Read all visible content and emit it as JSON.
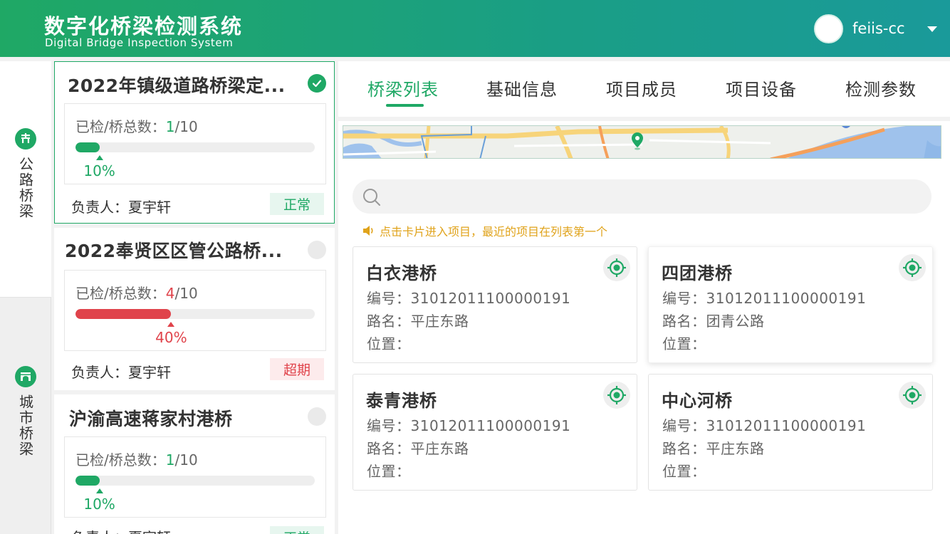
{
  "header": {
    "title": "数字化桥梁检测系统",
    "subtitle": "Digital Bridge Inspection System",
    "username": "feiis-cc"
  },
  "type_nav": {
    "items": [
      {
        "label": "公路桥梁",
        "icon": "highway-bridge-icon",
        "active": true
      },
      {
        "label": "城市桥梁",
        "icon": "city-bridge-icon",
        "active": false
      }
    ]
  },
  "projects": [
    {
      "name": "2022年镇级道路桥梁定...",
      "progress_label": "已检/桥总数：",
      "checked": "1",
      "total": "/10",
      "percent": 10,
      "percent_text": "10%",
      "owner": "负责人：夏宇轩",
      "status": "正常",
      "status_type": "ok",
      "selected": true
    },
    {
      "name": "2022奉贤区区管公路桥...",
      "progress_label": "已检/桥总数：",
      "checked": "4",
      "total": "/10",
      "percent": 40,
      "percent_text": "40%",
      "owner": "负责人：夏宇轩",
      "status": "超期",
      "status_type": "late",
      "selected": false
    },
    {
      "name": "沪渝高速蒋家村港桥",
      "progress_label": "已检/桥总数：",
      "checked": "1",
      "total": "/10",
      "percent": 10,
      "percent_text": "10%",
      "owner": "负责人：夏宇轩",
      "status": "正常",
      "status_type": "ok",
      "selected": false
    }
  ],
  "tabs": [
    {
      "label": "桥梁列表",
      "active": true
    },
    {
      "label": "基础信息",
      "active": false
    },
    {
      "label": "项目成员",
      "active": false
    },
    {
      "label": "项目设备",
      "active": false
    },
    {
      "label": "检测参数",
      "active": false
    }
  ],
  "search": {
    "placeholder": ""
  },
  "hint": "点击卡片进入项目，最近的项目在列表第一个",
  "bridges": [
    {
      "name": "白衣港桥",
      "code": "编号：31012011100000191",
      "road": "路名：平庄东路",
      "location": "位置："
    },
    {
      "name": "四团港桥",
      "code": "编号：31012011100000191",
      "road": "路名：团青公路",
      "location": "位置："
    },
    {
      "name": "泰青港桥",
      "code": "编号：31012011100000191",
      "road": "路名：平庄东路",
      "location": "位置："
    },
    {
      "name": "中心河桥",
      "code": "编号：31012011100000191",
      "road": "路名：平庄东路",
      "location": "位置："
    }
  ],
  "colors": {
    "brand": "#1fa865",
    "danger": "#e0434b",
    "hint": "#e0a31b"
  }
}
